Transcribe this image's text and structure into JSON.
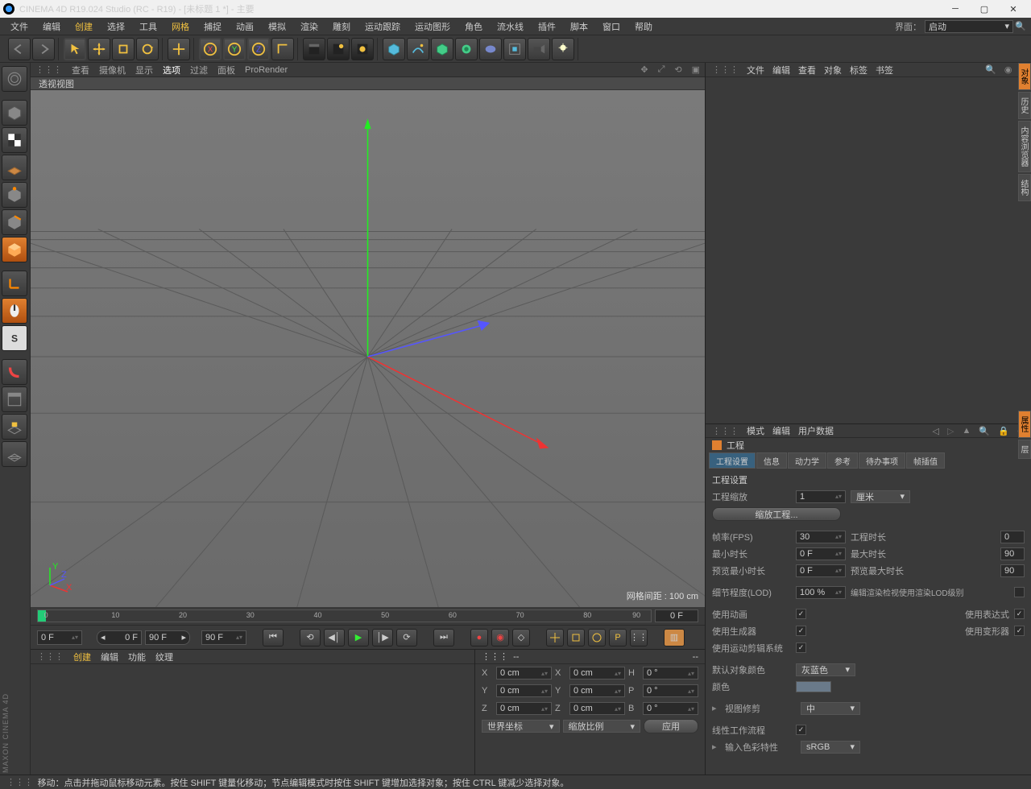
{
  "title": "CINEMA 4D R19.024 Studio (RC - R19) - [未标题 1 *] - 主要",
  "menubar": [
    "文件",
    "编辑",
    "创建",
    "选择",
    "工具",
    "网格",
    "捕捉",
    "动画",
    "模拟",
    "渲染",
    "雕刻",
    "运动跟踪",
    "运动图形",
    "角色",
    "流水线",
    "插件",
    "脚本",
    "窗口",
    "帮助"
  ],
  "menubar_hl": [
    2,
    5
  ],
  "interface_label": "界面：",
  "interface_value": "启动",
  "viewport": {
    "menus": [
      "查看",
      "摄像机",
      "显示",
      "选项",
      "过滤",
      "面板",
      "ProRender"
    ],
    "active": 3,
    "subtitle": "透视视图",
    "grid_label": "网格间距 : 100 cm"
  },
  "timeline": {
    "ticks": [
      "0",
      "10",
      "20",
      "30",
      "40",
      "50",
      "60",
      "70",
      "80",
      "90"
    ],
    "end": "0 F",
    "f1": "0 F",
    "f2": "0 F",
    "f3": "90 F",
    "f4": "90 F"
  },
  "materials": {
    "menus": [
      "创建",
      "编辑",
      "功能",
      "纹理"
    ],
    "hl": 0
  },
  "coords": {
    "hdr": "--",
    "x_lbl": "X",
    "y_lbl": "Y",
    "z_lbl": "Z",
    "x": "0 cm",
    "y": "0 cm",
    "z": "0 cm",
    "sx_lbl": "X",
    "sy_lbl": "Y",
    "sz_lbl": "Z",
    "sx": "0 cm",
    "sy": "0 cm",
    "sz": "0 cm",
    "h_lbl": "H",
    "p_lbl": "P",
    "b_lbl": "B",
    "h": "0 °",
    "p": "0 °",
    "b": "0 °",
    "sys": "世界坐标",
    "mode": "缩放比例",
    "apply": "应用"
  },
  "obj_menus": [
    "文件",
    "编辑",
    "查看",
    "对象",
    "标签",
    "书签"
  ],
  "attr_menus": [
    "模式",
    "编辑",
    "用户数据"
  ],
  "attr_title": "工程",
  "tabs": [
    "工程设置",
    "信息",
    "动力学",
    "参考",
    "待办事项",
    "帧插值"
  ],
  "props": {
    "section": "工程设置",
    "scale_lbl": "工程缩放",
    "scale_val": "1",
    "scale_unit": "厘米",
    "scale_btn": "缩放工程...",
    "fps_lbl": "帧率(FPS)",
    "fps": "30",
    "proj_time_lbl": "工程时长",
    "proj_time": "0",
    "min_lbl": "最小时长",
    "min": "0 F",
    "max_lbl": "最大时长",
    "max": "90",
    "pmin_lbl": "预览最小时长",
    "pmin": "0 F",
    "pmax_lbl": "预览最大时长",
    "pmax": "90",
    "lod_lbl": "细节程度(LOD)",
    "lod": "100 %",
    "lod_chk_lbl": "编辑渲染检视使用渲染LOD级别",
    "anim_lbl": "使用动画",
    "expr_lbl": "使用表达式",
    "gen_lbl": "使用生成器",
    "def_lbl": "使用变形器",
    "mot_lbl": "使用运动剪辑系统",
    "col_lbl": "默认对象颜色",
    "col_val": "灰蓝色",
    "color_lbl": "颜色",
    "clip_lbl": "视图修剪",
    "clip_val": "中",
    "lin_lbl": "线性工作流程",
    "cs_lbl": "输入色彩特性",
    "cs_val": "sRGB"
  },
  "status": "移动：点击并拖动鼠标移动元素。按住 SHIFT 键量化移动；节点编辑模式时按住 SHIFT 键增加选择对象；按住 CTRL 键减少选择对象。",
  "vtabs": [
    "对象",
    "历史",
    "内容浏览器",
    "结构"
  ],
  "vtabs2": [
    "属性",
    "层"
  ],
  "brand": "MAXON CINEMA 4D"
}
